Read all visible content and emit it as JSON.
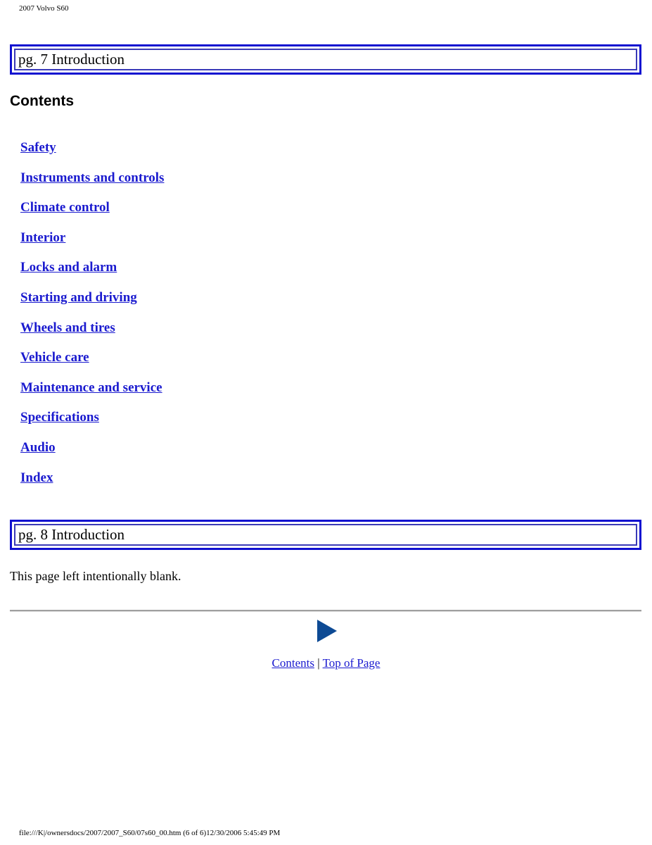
{
  "running_header": "2007 Volvo S60",
  "sections": [
    {
      "title": "pg. 7 Introduction"
    },
    {
      "title": "pg. 8 Introduction"
    }
  ],
  "contents": {
    "heading": "Contents",
    "links": [
      "Safety",
      "Instruments and controls",
      "Climate control",
      "Interior",
      "Locks and alarm",
      "Starting and driving",
      "Wheels and tires",
      "Vehicle care",
      "Maintenance and service",
      "Specifications",
      "Audio",
      "Index"
    ]
  },
  "blank_page_text": "This page left intentionally blank.",
  "navigation": {
    "next_icon": "next-arrow-icon",
    "contents_label": "Contents",
    "separator": "|",
    "top_label": "Top of Page",
    "arrow_color": "#0d4a94",
    "link_color": "#1a1acf"
  },
  "running_footer": "file:///K|/ownersdocs/2007/2007_S60/07s60_00.htm (6 of 6)12/30/2006 5:45:49 PM"
}
